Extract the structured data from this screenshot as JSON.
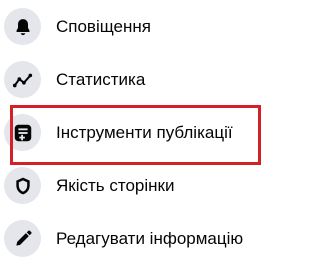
{
  "menu": {
    "items": [
      {
        "label": "Сповіщення",
        "icon": "bell-icon"
      },
      {
        "label": "Статистика",
        "icon": "trend-line-icon"
      },
      {
        "label": "Інструменти публікації",
        "icon": "publishing-tools-icon"
      },
      {
        "label": "Якість сторінки",
        "icon": "shield-icon"
      },
      {
        "label": "Редагувати інформацію",
        "icon": "pencil-icon"
      }
    ],
    "highlight_color": "#d32127",
    "icon_background": "#e4e6eb"
  }
}
